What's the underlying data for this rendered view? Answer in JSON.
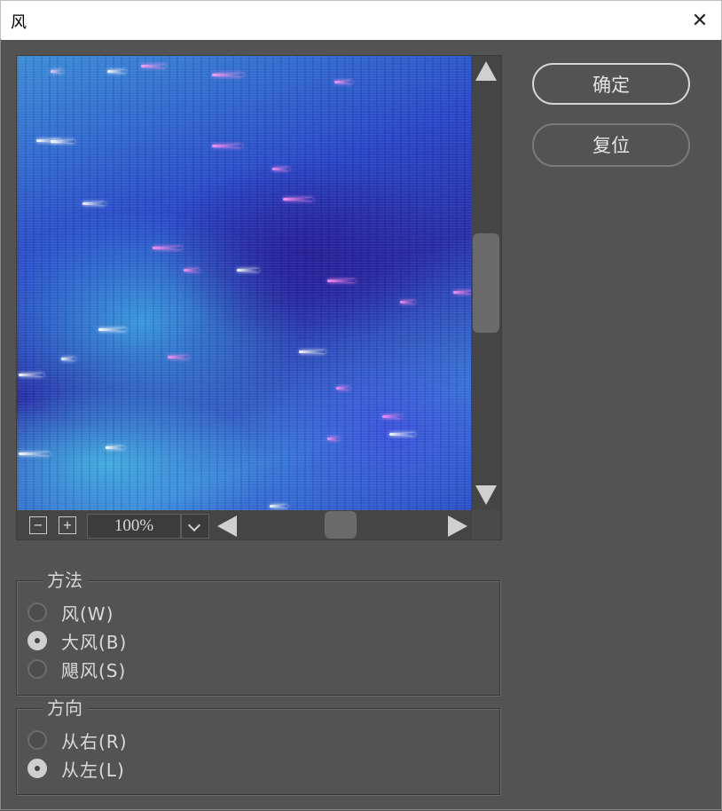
{
  "window": {
    "title": "风",
    "close_glyph": "✕"
  },
  "preview": {
    "zoom_out_glyph": "−",
    "zoom_in_glyph": "+",
    "zoom_value": "100%"
  },
  "buttons": {
    "ok_label": "确定",
    "reset_label": "复位"
  },
  "method": {
    "legend": "方法",
    "options": [
      {
        "label": "风(W)",
        "checked": false
      },
      {
        "label": "大风(B)",
        "checked": true
      },
      {
        "label": "飓风(S)",
        "checked": false
      }
    ]
  },
  "direction": {
    "legend": "方向",
    "options": [
      {
        "label": "从右(R)",
        "checked": false
      },
      {
        "label": "从左(L)",
        "checked": true
      }
    ]
  }
}
